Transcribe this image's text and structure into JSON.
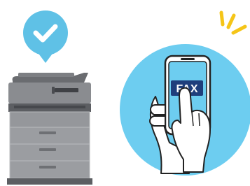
{
  "phone": {
    "screen_label": "FAX"
  },
  "icons": {
    "check_badge": "check-icon",
    "printer": "printer-icon",
    "phone": "smartphone-icon",
    "hands": "hand-icon",
    "alert_rays": "notification-rays-icon"
  },
  "colors": {
    "badge_blue": "#5fc1e6",
    "circle_blue": "#6dcdf0",
    "printer_gray": "#8a8c90",
    "printer_dark": "#5c5e62",
    "fax_label_navy": "#1f3e7c",
    "ray_yellow": "#f5c518",
    "outline": "#222222"
  }
}
